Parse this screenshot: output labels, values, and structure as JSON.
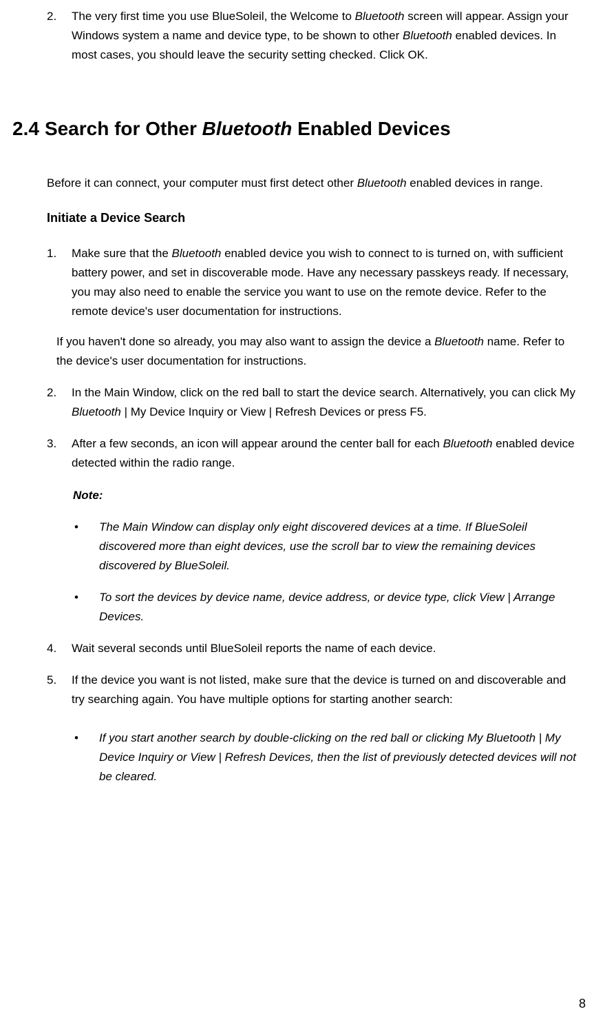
{
  "top": {
    "num": "2.",
    "seg1": "The very first time you use BlueSoleil, the Welcome to ",
    "seg2": "Bluetooth",
    "seg3": " screen will appear. Assign your Windows system a name and device type, to be shown to other ",
    "seg4": "Bluetooth",
    "seg5": " enabled devices. In most cases, you should leave the security setting checked. Click OK."
  },
  "heading": {
    "num": "2.4",
    "t1": "Search for Other ",
    "t2": "Bluetooth",
    "t3": " Enabled Devices"
  },
  "intro": {
    "a": "Before it can connect, your computer must first detect other ",
    "b": "Bluetooth",
    "c": " enabled devices in range."
  },
  "subhead": "Initiate a Device Search",
  "s1": {
    "num": "1.",
    "a": "Make sure that the ",
    "b": "Bluetooth",
    "c": " enabled device you wish to connect to is turned on, with sufficient battery power, and set in discoverable mode. Have any necessary passkeys ready. If necessary, you may also need to enable the service you want to use on the remote device. Refer to the remote device's user documentation for instructions."
  },
  "s1b": {
    "a": "If you haven't done so already, you may also want to assign the device a ",
    "b": "Bluetooth",
    "c": " name. Refer to the device's user documentation for instructions."
  },
  "s2": {
    "num": "2.",
    "a": "In the Main Window, click on the red ball to start the device search. Alternatively, you can click My ",
    "b": "Bluetooth",
    "c": " | My Device Inquiry or View | Refresh Devices or press F5."
  },
  "s3": {
    "num": "3.",
    "a": "After a few seconds, an icon will appear around the center ball for each ",
    "b": "Bluetooth",
    "c": " enabled device detected within the radio range."
  },
  "note_label": "Note:",
  "n1": "The Main Window can display only eight discovered devices at a time. If BlueSoleil discovered more than eight devices, use the scroll bar to view the remaining devices discovered by BlueSoleil.",
  "n2": "To sort the devices by device name, device address, or device type, click View | Arrange Devices.",
  "s4": {
    "num": "4.",
    "a": "Wait several seconds until BlueSoleil reports the name of each device."
  },
  "s5": {
    "num": "5.",
    "a": "If the device you want is not listed, make sure that the device is turned on and discoverable and try searching again. You have multiple options for starting another search:"
  },
  "b1": "If you start another search by double-clicking on the red ball or clicking My Bluetooth | My Device Inquiry or View | Refresh Devices, then the list of previously detected devices will not be cleared.",
  "bullet": "•",
  "page_num": "8"
}
